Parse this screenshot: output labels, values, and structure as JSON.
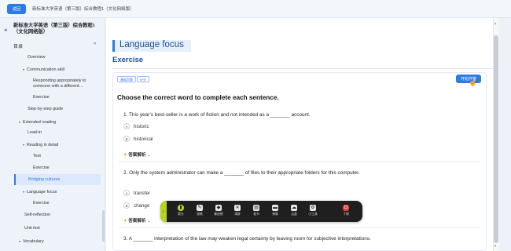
{
  "topbar": {
    "back_label": "返回",
    "book_title": "新标准大学英语（第三版）综合教程1（文化网络版）"
  },
  "sidebar": {
    "title": "新标准大学英语（第三版）综合教程1（文化网络版）",
    "toc_label": "目录",
    "items": [
      {
        "label": "Overview",
        "caret": false,
        "indent": 1
      },
      {
        "label": "Communication skill",
        "caret": true,
        "indent": 1
      },
      {
        "label": "Responding appropriately to someone with a different…",
        "caret": false,
        "indent": 2
      },
      {
        "label": "Exercise",
        "caret": false,
        "indent": 2
      },
      {
        "label": "Step-by-step guide",
        "caret": false,
        "indent": 1
      },
      {
        "label": "Extended reading",
        "caret": true,
        "indent": 0
      },
      {
        "label": "Lead-in",
        "caret": false,
        "indent": 1
      },
      {
        "label": "Reading in detail",
        "caret": true,
        "indent": 1
      },
      {
        "label": "Text",
        "caret": false,
        "indent": 2
      },
      {
        "label": "Exercise",
        "caret": false,
        "indent": 2
      },
      {
        "label": "Bridging cultures",
        "caret": false,
        "indent": 1,
        "active": true
      },
      {
        "label": "Language focus",
        "caret": true,
        "indent": 1
      },
      {
        "label": "Exercise",
        "caret": false,
        "indent": 2
      },
      {
        "label": "Self-reflection",
        "caret": false,
        "indent": 0
      },
      {
        "label": "Unit test",
        "caret": false,
        "indent": 0
      },
      {
        "label": "Vocabulary",
        "caret": true,
        "indent": 0
      }
    ]
  },
  "main": {
    "section_title": "Language focus",
    "exercise_title": "Exercise",
    "tags": [
      "基础判题",
      "计分"
    ],
    "start_label": "开始作答",
    "instruction": "Choose the correct word to complete each sentence.",
    "analysis_label": "答案解析",
    "questions": [
      {
        "text": "1. This year’s best-seller is a work of fiction and not intended as a _______ account.",
        "options": [
          {
            "letter": "A",
            "text": "historic"
          },
          {
            "letter": "B",
            "text": "historical"
          }
        ]
      },
      {
        "text": "2. Only the system administrator can make a _______ of files to their appropriate folders for this computer.",
        "options": [
          {
            "letter": "A",
            "text": "transfer"
          },
          {
            "letter": "B",
            "text": "change"
          }
        ]
      },
      {
        "text": "3. A _______ interpretation of the law may weaken legal certainty by leaving room for subjective interpretations."
      }
    ]
  },
  "toolbar": {
    "tools": [
      {
        "icon": "pointer-icon",
        "label": "箭头"
      },
      {
        "icon": "pen-icon",
        "label": "画笔"
      },
      {
        "icon": "eraser-icon",
        "label": "橡皮擦"
      },
      {
        "icon": "clear-icon",
        "label": "清屏"
      },
      {
        "icon": "board-icon",
        "label": "板书"
      },
      {
        "icon": "comment-icon",
        "label": "弹幕"
      },
      {
        "icon": "cloud-icon",
        "label": "云盘"
      },
      {
        "icon": "tools-icon",
        "label": "小工具"
      },
      {
        "icon": "end-class-icon",
        "label": "下课"
      }
    ],
    "colors": {
      "grip": "#b5d61c",
      "end_class": "#e8413a",
      "background": "#1f1f1f"
    }
  },
  "colors": {
    "accent": "#2d7be6",
    "heading": "#1d4f9a"
  }
}
